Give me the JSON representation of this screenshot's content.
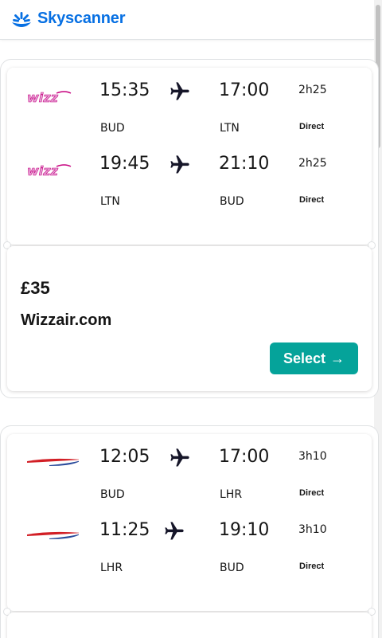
{
  "header": {
    "brand": "Skyscanner"
  },
  "results": [
    {
      "legs": [
        {
          "airline_icon": "wizzair-logo",
          "dep_time": "15:35",
          "arr_time": "17:00",
          "dep_airport": "BUD",
          "arr_airport": "LTN",
          "duration": "2h25",
          "stops": "Direct"
        },
        {
          "airline_icon": "wizzair-logo",
          "dep_time": "19:45",
          "arr_time": "21:10",
          "dep_airport": "LTN",
          "arr_airport": "BUD",
          "duration": "2h25",
          "stops": "Direct"
        }
      ],
      "price": "£35",
      "provider": "Wizzair.com",
      "select_label": "Select",
      "select_icon": "arrow-right-icon"
    },
    {
      "legs": [
        {
          "airline_icon": "british-airways-logo",
          "dep_time": "12:05",
          "arr_time": "17:00",
          "dep_airport": "BUD",
          "arr_airport": "LHR",
          "duration": "3h10",
          "stops": "Direct"
        },
        {
          "airline_icon": "british-airways-logo",
          "dep_time": "11:25",
          "arr_time": "19:10",
          "dep_airport": "LHR",
          "arr_airport": "BUD",
          "duration": "3h10",
          "stops": "Direct"
        }
      ]
    }
  ],
  "colors": {
    "brand": "#0770e3",
    "select_button": "#05a39a",
    "text": "#161616"
  }
}
